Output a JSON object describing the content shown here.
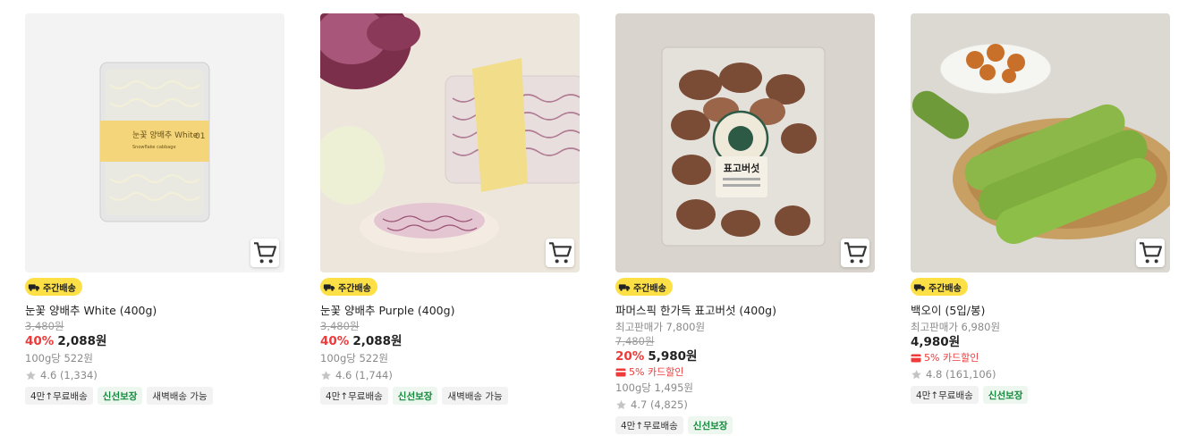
{
  "products": [
    {
      "badge": "주간배송",
      "name": "눈꽃 양배추 White (400g)",
      "original_price": "3,480원",
      "discount_rate": "40%",
      "sale_price": "2,088원",
      "unit_price": "100g당 522원",
      "rating": "4.6 (1,334)",
      "tags": [
        "4만↑무료배송",
        "신선보장",
        "새벽배송 가능"
      ]
    },
    {
      "badge": "주간배송",
      "name": "눈꽃 양배추 Purple (400g)",
      "original_price": "3,480원",
      "discount_rate": "40%",
      "sale_price": "2,088원",
      "unit_price": "100g당 522원",
      "rating": "4.6 (1,744)",
      "tags": [
        "4만↑무료배송",
        "신선보장",
        "새벽배송 가능"
      ]
    },
    {
      "badge": "주간배송",
      "name": "파머스픽 한가득 표고버섯 (400g)",
      "highest_price_label": "최고판매가 7,800원",
      "original_price": "7,480원",
      "discount_rate": "20%",
      "sale_price": "5,980원",
      "card_discount": "5% 카드할인",
      "unit_price": "100g당 1,495원",
      "rating": "4.7 (4,825)",
      "tags": [
        "4만↑무료배송",
        "신선보장"
      ]
    },
    {
      "badge": "주간배송",
      "name": "백오이 (5입/봉)",
      "highest_price_label": "최고판매가 6,980원",
      "sale_price": "4,980원",
      "card_discount": "5% 카드할인",
      "rating": "4.8 (161,106)",
      "tags": [
        "4만↑무료배송",
        "신선보장"
      ]
    }
  ],
  "product_images": [
    {
      "package_label": "눈꽃 양배추 White"
    },
    {
      "package_label": ""
    },
    {
      "package_label": "표고버섯"
    },
    {
      "package_label": ""
    }
  ],
  "colors": {
    "badge_yellow": "#fde046",
    "discount_red": "#f03a3a",
    "fresh_green": "#108a3a"
  },
  "icons": {
    "cart": "cart-icon",
    "badge": "delivery-truck-icon",
    "star": "star-icon",
    "card": "credit-card-icon"
  }
}
